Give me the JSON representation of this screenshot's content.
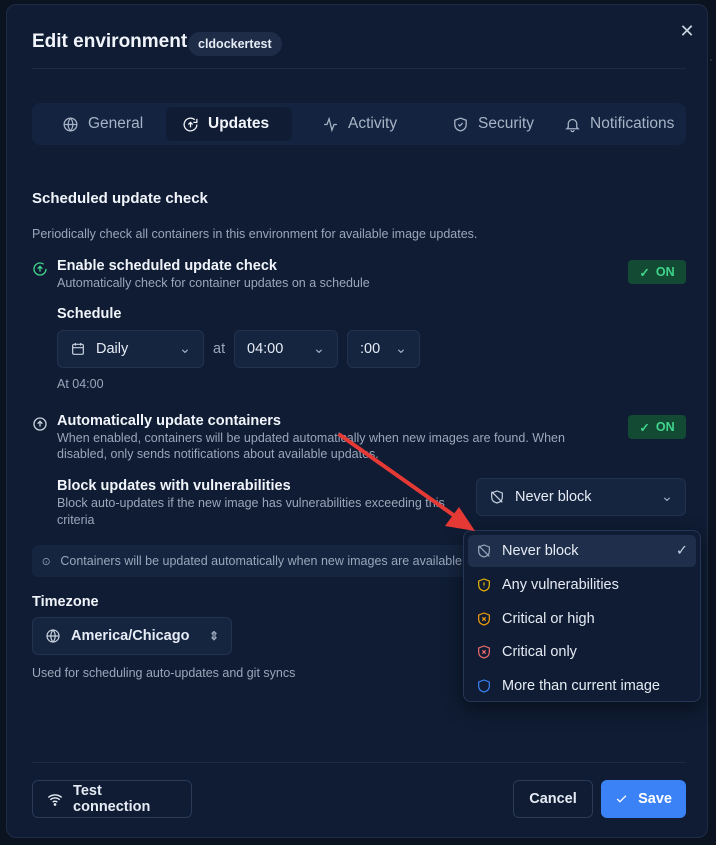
{
  "header": {
    "title": "Edit environment",
    "env_badge": "cldockertest"
  },
  "tabs": [
    {
      "label": "General",
      "icon": "globe-icon"
    },
    {
      "label": "Updates",
      "icon": "refresh-up-icon"
    },
    {
      "label": "Activity",
      "icon": "activity-icon"
    },
    {
      "label": "Security",
      "icon": "shield-check-icon"
    },
    {
      "label": "Notifications",
      "icon": "bell-icon"
    }
  ],
  "active_tab": "Updates",
  "scheduled": {
    "title": "Scheduled update check",
    "description": "Periodically check all containers in this environment for available image updates.",
    "enable_label": "Enable scheduled update check",
    "enable_desc": "Automatically check for container updates on a schedule",
    "toggle_text": "ON",
    "schedule_label": "Schedule",
    "frequency": "Daily",
    "at_text": "at",
    "hour": "04:00",
    "minute": ":00",
    "summary": "At 04:00"
  },
  "auto_update": {
    "title": "Automatically update containers",
    "desc_line1": "When enabled, containers will be updated automatically when new images are found. When",
    "desc_line2": "disabled, only sends notifications about available updates.",
    "toggle_text": "ON"
  },
  "block": {
    "title": "Block updates with vulnerabilities",
    "desc_line1": "Block auto-updates if the new image has vulnerabilities exceeding this",
    "desc_line2": "criteria",
    "selected": "Never block",
    "options": [
      {
        "label": "Never block",
        "icon": "shield-off-icon",
        "color": "#9aa7ba"
      },
      {
        "label": "Any vulnerabilities",
        "icon": "shield-alert-icon",
        "color": "#eab308"
      },
      {
        "label": "Critical or high",
        "icon": "shield-x-icon",
        "color": "#f59e0b"
      },
      {
        "label": "Critical only",
        "icon": "shield-x-icon",
        "color": "#ef6b6b"
      },
      {
        "label": "More than current image",
        "icon": "shield-icon",
        "color": "#3b82f6"
      }
    ]
  },
  "info_text": "Containers will be updated automatically when new images are available",
  "timezone": {
    "label": "Timezone",
    "value": "America/Chicago",
    "hint": "Used for scheduling auto-updates and git syncs"
  },
  "footer": {
    "test_label": "Test connection",
    "cancel_label": "Cancel",
    "save_label": "Save"
  },
  "colors": {
    "accent": "#3b82f6",
    "toggle_on": "#41d48b",
    "arrow": "#e53935"
  }
}
